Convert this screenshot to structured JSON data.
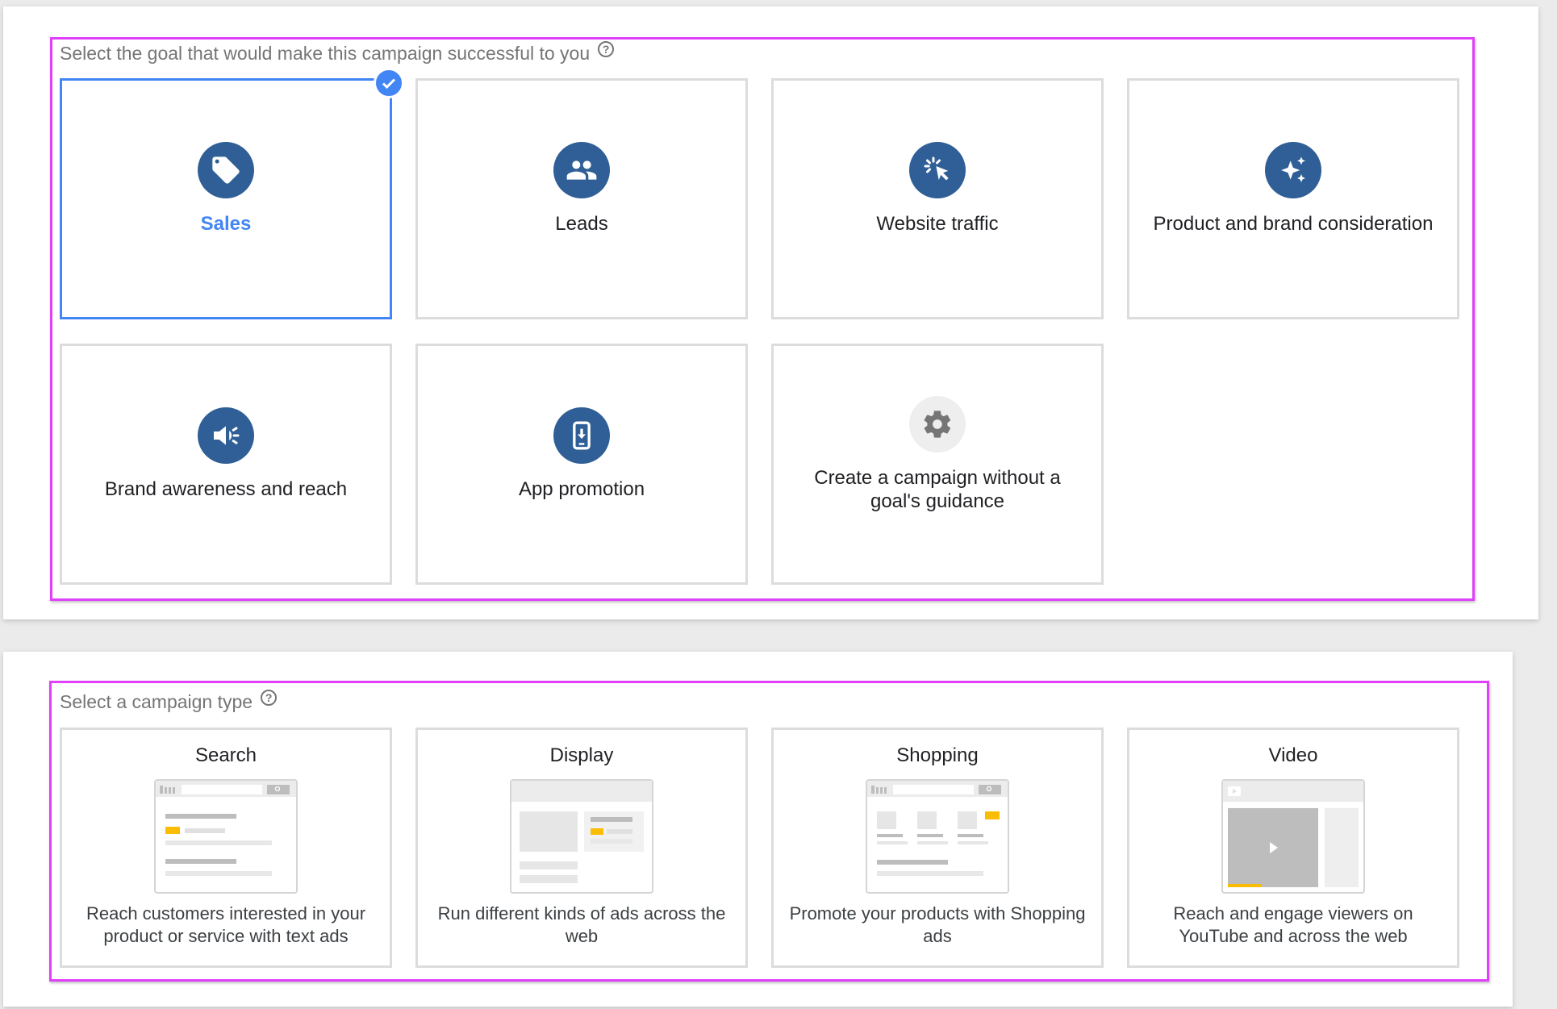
{
  "goal_section": {
    "title": "Select the goal that would make this campaign successful to you",
    "help": "?",
    "goals": [
      {
        "label": "Sales",
        "icon": "tag-icon",
        "selected": true
      },
      {
        "label": "Leads",
        "icon": "people-icon",
        "selected": false
      },
      {
        "label": "Website traffic",
        "icon": "cursor-click-icon",
        "selected": false
      },
      {
        "label": "Product and brand consideration",
        "icon": "sparkle-icon",
        "selected": false
      },
      {
        "label": "Brand awareness and reach",
        "icon": "megaphone-icon",
        "selected": false
      },
      {
        "label": "App promotion",
        "icon": "phone-download-icon",
        "selected": false
      },
      {
        "label": "Create a campaign without a goal's guidance",
        "icon": "gear-icon",
        "selected": false
      }
    ]
  },
  "type_section": {
    "title": "Select a campaign type",
    "help": "?",
    "types": [
      {
        "title": "Search",
        "description": "Reach customers interested in your product or service with text ads",
        "illustration": "search-results-illustration"
      },
      {
        "title": "Display",
        "description": "Run different kinds of ads across the web",
        "illustration": "display-ads-illustration"
      },
      {
        "title": "Shopping",
        "description": "Promote your products with Shopping ads",
        "illustration": "shopping-ads-illustration"
      },
      {
        "title": "Video",
        "description": "Reach and engage viewers on YouTube and across the web",
        "illustration": "video-player-illustration"
      }
    ]
  },
  "colors": {
    "selected_accent": "#4285f4",
    "icon_circle": "#2f5f96",
    "highlight_outline": "#e040fb",
    "illustration_accent": "#fbbc04"
  }
}
